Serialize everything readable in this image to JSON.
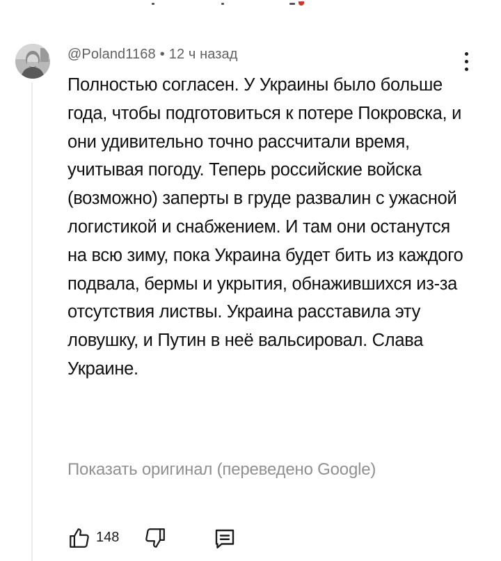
{
  "comment": {
    "author": "@Poland1168",
    "separator": "•",
    "time": "12 ч назад",
    "text": "Полностью согласен. У Украины было больше года, чтобы подготовиться к потере Покровска, и они удивительно точно рассчитали время, учитывая погоду. Теперь российские войска (возможно) заперты в груде развалин с ужасной логистикой и снабжением. И там они останутся на всю зиму, пока Украина будет бить из каждого подвала, бермы и укрытия, обнажившихся из-за отсутствия листвы. Украина расставила эту ловушку, и Путин в неё вальсировал. Слава Украине.",
    "translate_link": "Показать оригинал (переведено Google)",
    "like_count": "148",
    "icons": {
      "menu": "more-vertical-icon",
      "like": "thumbs-up-icon",
      "dislike": "thumbs-down-icon",
      "reply": "comment-reply-icon"
    }
  }
}
